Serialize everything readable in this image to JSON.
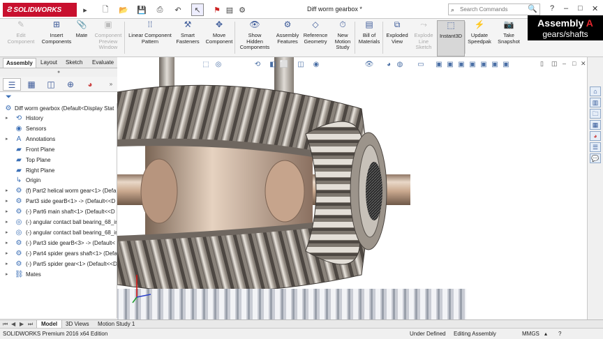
{
  "app": {
    "logo_text": "SOLIDWORKS",
    "document_title": "Diff worm gearbox *",
    "search_placeholder": "Search Commands",
    "help_label": "?"
  },
  "overlay": {
    "line1_prefix": "Assembly",
    "line1_accent": "A",
    "line2": "gears/shafts"
  },
  "commands": [
    {
      "id": "edit-component",
      "label": "Edit\nComponent",
      "icon": "edit-component-icon",
      "disabled": true
    },
    {
      "id": "insert-components",
      "label": "Insert\nComponents",
      "icon": "insert-components-icon",
      "disabled": false
    },
    {
      "id": "mate",
      "label": "Mate",
      "icon": "mate-icon",
      "disabled": false
    },
    {
      "id": "component-preview",
      "label": "Component\nPreview\nWindow",
      "icon": "component-preview-icon",
      "disabled": true
    },
    {
      "id": "linear-pattern",
      "label": "Linear Component\nPattern",
      "icon": "linear-pattern-icon",
      "disabled": false
    },
    {
      "id": "smart-fasteners",
      "label": "Smart\nFasteners",
      "icon": "smart-fasteners-icon",
      "disabled": false
    },
    {
      "id": "move-component",
      "label": "Move\nComponent",
      "icon": "move-component-icon",
      "disabled": false
    },
    {
      "id": "show-hidden",
      "label": "Show\nHidden\nComponents",
      "icon": "show-hidden-icon",
      "disabled": false
    },
    {
      "id": "assembly-features",
      "label": "Assembly\nFeatures",
      "icon": "assembly-features-icon",
      "disabled": false
    },
    {
      "id": "reference-geometry",
      "label": "Reference\nGeometry",
      "icon": "reference-geometry-icon",
      "disabled": false
    },
    {
      "id": "new-motion-study",
      "label": "New\nMotion\nStudy",
      "icon": "motion-study-icon",
      "disabled": false
    },
    {
      "id": "bill-of-materials",
      "label": "Bill of\nMaterials",
      "icon": "bom-icon",
      "disabled": false
    },
    {
      "id": "exploded-view",
      "label": "Exploded\nView",
      "icon": "exploded-view-icon",
      "disabled": false
    },
    {
      "id": "explode-line-sketch",
      "label": "Explode\nLine\nSketch",
      "icon": "explode-line-icon",
      "disabled": true
    },
    {
      "id": "instant3d",
      "label": "Instant3D",
      "icon": "instant3d-icon",
      "disabled": false,
      "active": true
    },
    {
      "id": "update-speedpak",
      "label": "Update\nSpeedpak",
      "icon": "speedpak-icon",
      "disabled": false
    },
    {
      "id": "take-snapshot",
      "label": "Take\nSnapshot",
      "icon": "camera-icon",
      "disabled": false
    }
  ],
  "cm_tabs": [
    "Assembly",
    "Layout",
    "Sketch",
    "Evaluate"
  ],
  "tree": {
    "root": "Diff worm gearbox  (Default<Display Stat",
    "items": [
      {
        "label": "History",
        "icon": "history-icon",
        "expandable": true
      },
      {
        "label": "Sensors",
        "icon": "sensors-icon",
        "expandable": false
      },
      {
        "label": "Annotations",
        "icon": "annotations-icon",
        "expandable": true
      },
      {
        "label": "Front Plane",
        "icon": "plane-icon",
        "expandable": false
      },
      {
        "label": "Top Plane",
        "icon": "plane-icon",
        "expandable": false
      },
      {
        "label": "Right Plane",
        "icon": "plane-icon",
        "expandable": false
      },
      {
        "label": "Origin",
        "icon": "origin-icon",
        "expandable": false
      },
      {
        "label": "(f) Part2 helical worm gear<1> (Defa",
        "icon": "part-icon",
        "expandable": true
      },
      {
        "label": "Part3 side gearB<1> -> (Default<<D",
        "icon": "part-icon",
        "expandable": true
      },
      {
        "label": "(-) Part6 main shaft<1> (Default<<D",
        "icon": "part-icon",
        "expandable": true
      },
      {
        "label": "(-) angular contact ball bearing_68_in",
        "icon": "bearing-icon",
        "expandable": true
      },
      {
        "label": "(-) angular contact ball bearing_68_in",
        "icon": "bearing-icon",
        "expandable": true
      },
      {
        "label": "(-) Part3 side gearB<3> -> (Default<",
        "icon": "part-icon",
        "expandable": true
      },
      {
        "label": "(-) Part4 spider gears shaft<1> (Defa",
        "icon": "part-icon",
        "expandable": true
      },
      {
        "label": "(-) Part5 spider gear<1> (Default<<D",
        "icon": "part-icon",
        "expandable": true
      },
      {
        "label": "Mates",
        "icon": "mates-icon",
        "expandable": true
      }
    ]
  },
  "bottom_tabs": [
    "Model",
    "3D Views",
    "Motion Study 1"
  ],
  "status": {
    "edition": "SOLIDWORKS Premium 2016 x64 Edition",
    "definition": "Under Defined",
    "mode": "Editing Assembly",
    "units": "MMGS"
  },
  "colors": {
    "brand": "#c8102e",
    "gear_metal": "#b8b2aa",
    "shaft_bronze": "#c8a98c",
    "accent_blue": "#3b6fb6"
  }
}
